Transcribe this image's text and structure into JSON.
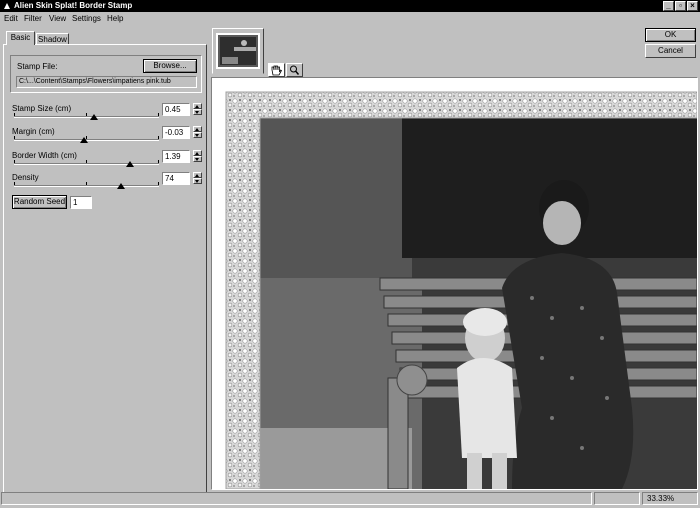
{
  "window": {
    "title": "Alien Skin Splat! Border Stamp"
  },
  "menu": [
    "Edit",
    "Filter",
    "View",
    "Settings",
    "Help"
  ],
  "tabs": {
    "basic": "Basic",
    "shadow": "Shadow"
  },
  "stamp": {
    "label": "Stamp File:",
    "browse": "Browse...",
    "path": "C:\\...\\Content\\Stamps\\Flowers\\impatiens pink.tub"
  },
  "sliders": [
    {
      "label": "Stamp Size (cm)",
      "value": "0.45",
      "level": 0.55
    },
    {
      "label": "Margin (cm)",
      "value": "-0.03",
      "level": 0.48
    },
    {
      "label": "Border Width (cm)",
      "value": "1.39",
      "level": 0.8
    },
    {
      "label": "Density",
      "value": "74",
      "level": 0.74
    }
  ],
  "random_seed": {
    "label": "Random Seed",
    "value": "1"
  },
  "actions": {
    "ok": "OK",
    "cancel": "Cancel"
  },
  "status": {
    "zoom": "33.33%"
  },
  "icons": {
    "hand": "hand-icon",
    "zoom": "magnifier-icon",
    "app": "app-icon"
  },
  "colors": {
    "face": "#c0c0c0",
    "title_bg": "#000000",
    "window_bg": "#ffffff"
  }
}
